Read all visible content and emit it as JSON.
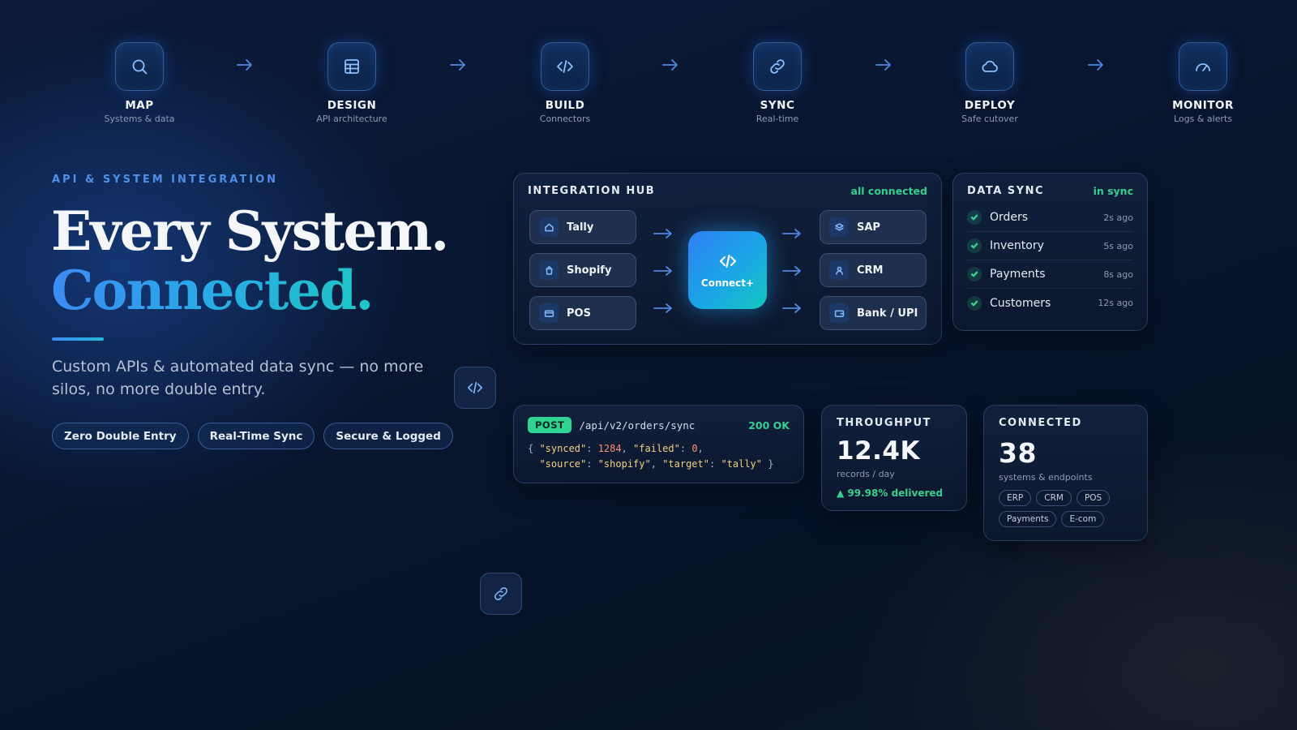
{
  "steps": [
    {
      "title": "MAP",
      "subtitle": "Systems & data",
      "icon": "search-icon"
    },
    {
      "title": "DESIGN",
      "subtitle": "API architecture",
      "icon": "grid-icon"
    },
    {
      "title": "BUILD",
      "subtitle": "Connectors",
      "icon": "code-icon"
    },
    {
      "title": "SYNC",
      "subtitle": "Real-time",
      "icon": "link-icon"
    },
    {
      "title": "DEPLOY",
      "subtitle": "Safe cutover",
      "icon": "cloud-icon"
    },
    {
      "title": "MONITOR",
      "subtitle": "Logs & alerts",
      "icon": "gauge-icon"
    }
  ],
  "hero": {
    "eyebrow": "API & SYSTEM INTEGRATION",
    "headline_line1": "Every System.",
    "headline_line2": "Connected.",
    "subtext": "Custom APIs & automated data sync — no more silos, no more double entry.",
    "pills": [
      "Zero Double Entry",
      "Real-Time Sync",
      "Secure & Logged"
    ]
  },
  "hub": {
    "title": "INTEGRATION HUB",
    "status": "all connected",
    "sources": [
      {
        "label": "Tally",
        "icon": "home-icon"
      },
      {
        "label": "Shopify",
        "icon": "shopping-bag-icon"
      },
      {
        "label": "POS",
        "icon": "card-icon"
      }
    ],
    "core_label": "Connect+",
    "targets": [
      {
        "label": "SAP",
        "icon": "layers-icon"
      },
      {
        "label": "CRM",
        "icon": "user-icon"
      },
      {
        "label": "Bank / UPI",
        "icon": "wallet-icon"
      }
    ]
  },
  "data_sync": {
    "title": "DATA SYNC",
    "status": "in sync",
    "rows": [
      {
        "name": "Orders",
        "time": "2s ago"
      },
      {
        "name": "Inventory",
        "time": "5s ago"
      },
      {
        "name": "Payments",
        "time": "8s ago"
      },
      {
        "name": "Customers",
        "time": "12s ago"
      }
    ]
  },
  "api": {
    "method": "POST",
    "path": "/api/v2/orders/sync",
    "status": "200 OK",
    "response": {
      "synced": "1284",
      "failed": "0",
      "source": "\"shopify\"",
      "target": "\"tally\""
    }
  },
  "throughput": {
    "title": "THROUGHPUT",
    "value": "12.4K",
    "unit": "records / day",
    "delivered": "▲ 99.98% delivered"
  },
  "connected": {
    "title": "CONNECTED",
    "value": "38",
    "unit": "systems & endpoints",
    "tags": [
      "ERP",
      "CRM",
      "POS",
      "Payments",
      "E-com"
    ]
  },
  "colors": {
    "accent_blue": "#3d8bf2",
    "accent_teal": "#1fc7c6",
    "success_green": "#35d08f",
    "background": "#081630"
  }
}
